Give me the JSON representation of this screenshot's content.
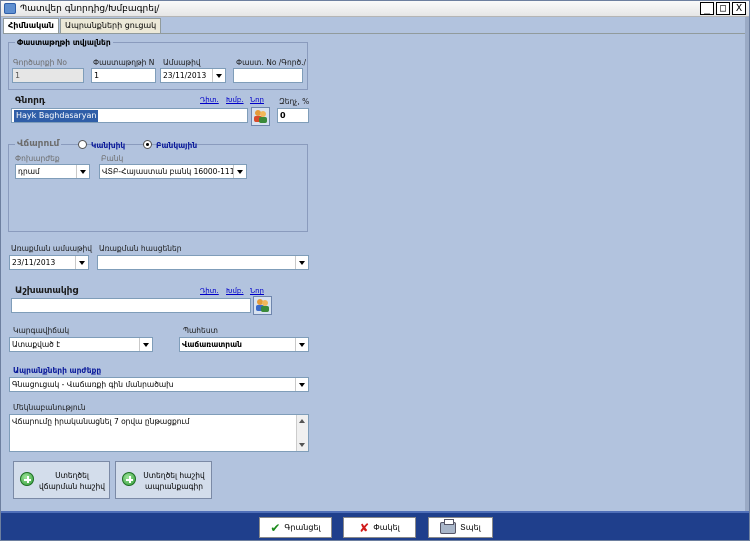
{
  "window": {
    "title": "Պատվեր գնորդից/Խմբագրել/",
    "controls": {
      "minimize": "_",
      "maximize": "□",
      "close": "X"
    }
  },
  "tabs": [
    {
      "label": "Հիմնական",
      "active": true
    },
    {
      "label": "Ապրանքների ցուցակ",
      "active": false
    }
  ],
  "document_details": {
    "group_title": "Փաստաթղթի տվյալներ",
    "doc_type_label": "Գործարքի Nօ",
    "doc_type_value": "1",
    "doc_number_label": "Փաստաթղթի N",
    "doc_number_value": "1",
    "date_label": "Ամսաթիվ",
    "date_value": "23/11/2013",
    "external_label": "Փաստ. Nօ /Գործ./",
    "external_value": ""
  },
  "buyer": {
    "label": "Գնորդ",
    "link_search": "Դիտ.",
    "link_edit": "Խմբ.",
    "link_new": "Նոր",
    "value": "Hayk Baghdasaryan",
    "discount_label": "Զեղչ, %",
    "discount_value": "0"
  },
  "payment": {
    "group_title": "Վճարում",
    "option_cash": "Կանխիկ",
    "option_bank": "Բանկային",
    "selected": "bank",
    "currency_label": "Փոխարժեք",
    "currency_value": "դրամ",
    "bank_label": "Բանկ",
    "bank_value": "ՎՏԲ-Հայաստան բանկ 16000-11111"
  },
  "delivery": {
    "date_label": "Առաքման ամսաթիվ",
    "date_value": "23/11/2013",
    "address_label": "Առաքման հասցեներ",
    "address_value": ""
  },
  "supplier": {
    "label": "Աշխատակից",
    "link_search": "Դիտ.",
    "link_edit": "Խմբ.",
    "link_new": "Նոր",
    "value": ""
  },
  "status": {
    "state_label": "Կարգավիճակ",
    "state_value": "Ատաքված է",
    "status_label": "Պահեստ",
    "status_value": "Վաճառատրան"
  },
  "price_type": {
    "label": "Ապրանքների արժեքը",
    "value": "Գնացուցակ - Վաճառքի գին մանրածախ"
  },
  "comment": {
    "label": "Մեկնաբանություն",
    "value": "Վճարումը իրականացնել 7 օրվա ընթացքում"
  },
  "action_buttons": {
    "create_payment": "Ստեղծել վճարման հաշիվ",
    "create_invoice": "Ստեղծել հաշիվ ապրանքագիր"
  },
  "bottom_buttons": {
    "save": "Գրանցել",
    "close": "Փակել",
    "print": "Տպել"
  }
}
